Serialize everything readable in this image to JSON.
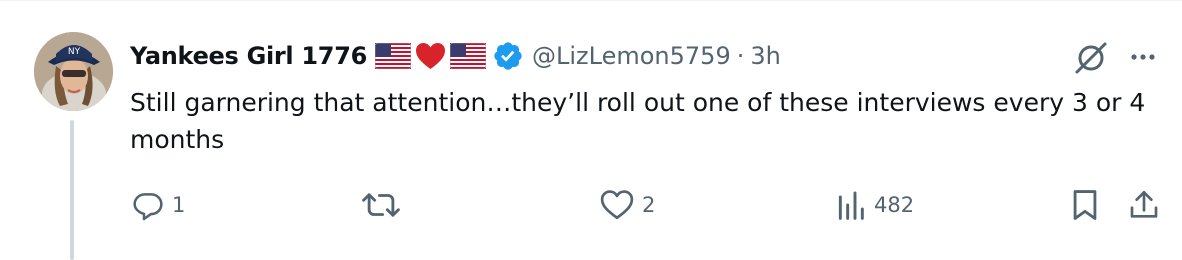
{
  "post": {
    "display_name": "Yankees Girl 1776",
    "handle": "@LizLemon5759",
    "separator": "·",
    "time": "3h",
    "text": "Still garnering that attention…they’ll roll out one of these interviews every 3 or 4 months",
    "verified": true,
    "name_emojis": [
      "flag-us",
      "red-heart",
      "flag-us"
    ]
  },
  "actions": {
    "reply_count": "1",
    "repost_count": "",
    "like_count": "2",
    "views_count": "482"
  },
  "colors": {
    "text": "#0f1419",
    "secondary": "#536471",
    "verified_blue": "#1d9bf0",
    "heart_red": "#d8232a",
    "thread_line": "#cfd9de"
  }
}
